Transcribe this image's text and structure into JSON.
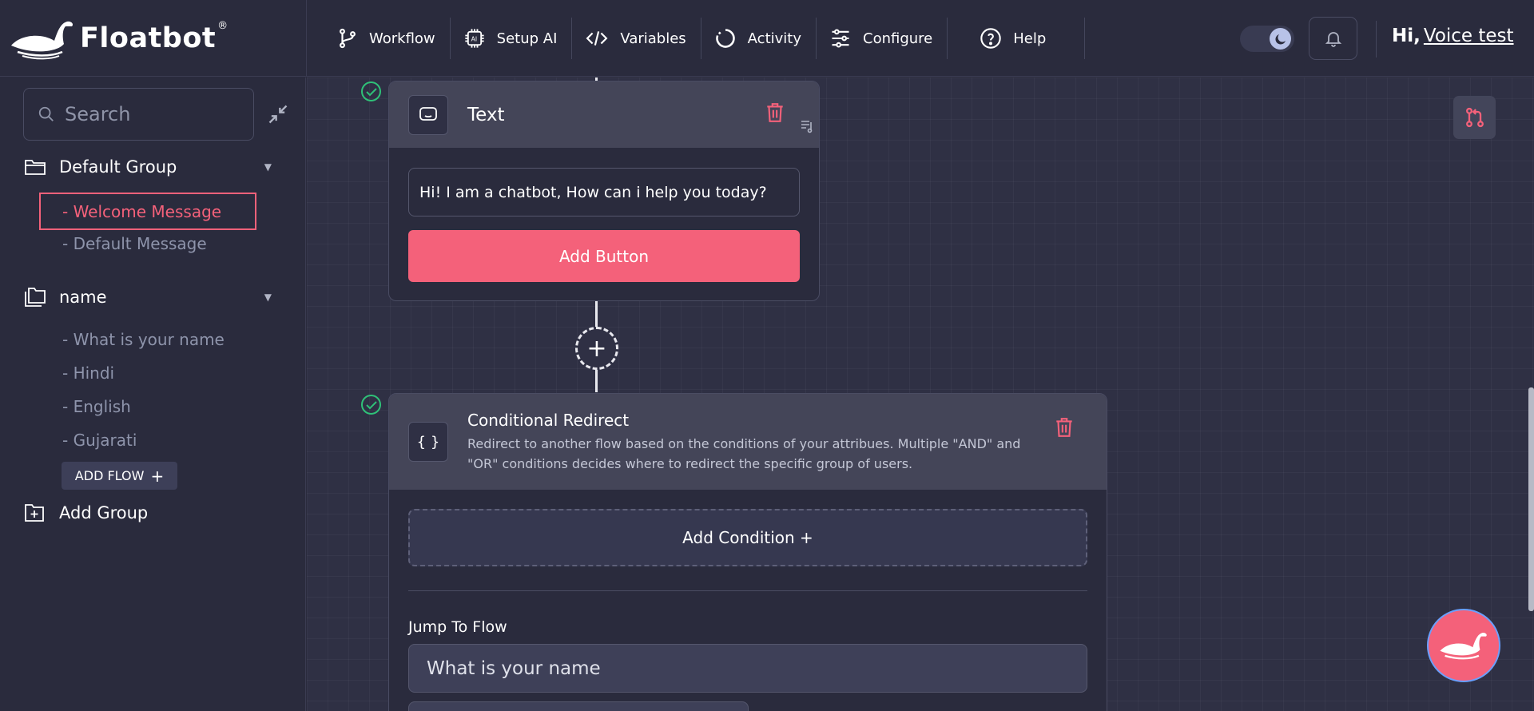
{
  "brand": {
    "name": "Floatbot",
    "reg": "®"
  },
  "nav": {
    "workflow": "Workflow",
    "setup_ai": "Setup AI",
    "variables": "Variables",
    "activity": "Activity",
    "configure": "Configure",
    "help": "Help"
  },
  "user": {
    "greeting": "Hi,",
    "name": "Voice test"
  },
  "sidebar": {
    "search_placeholder": "Search",
    "groups": [
      {
        "label": "Default Group",
        "items": [
          "- Welcome Message",
          "- Default Message"
        ]
      },
      {
        "label": "name",
        "items": [
          "- What is your name",
          "- Hindi",
          "- English",
          "- Gujarati"
        ]
      }
    ],
    "add_flow": "ADD FLOW",
    "add_flow_plus": "+",
    "add_group": "Add Group"
  },
  "canvas": {
    "text_card": {
      "title": "Text",
      "message": "Hi! I am a chatbot, How can i help you today?",
      "add_button": "Add Button"
    },
    "plus": "+",
    "cond_card": {
      "icon": "{ }",
      "title": "Conditional Redirect",
      "description": "Redirect to another flow based on the conditions of your attribues. Multiple \"AND\" and \"OR\" conditions decides where to redirect the specific group of users.",
      "add_condition": "Add Condition +",
      "jump_label": "Jump To Flow",
      "jump_value": "What is your name"
    }
  },
  "colors": {
    "accent": "#f4617a",
    "success": "#2fc178",
    "bg": "#2a2b3d",
    "canvas": "#2f3044"
  }
}
